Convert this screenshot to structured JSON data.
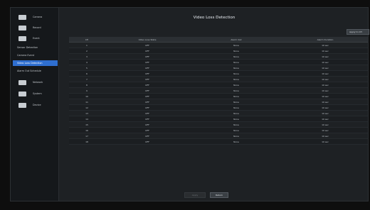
{
  "header": {
    "title": "Video Loss Detection"
  },
  "sidebar": {
    "items": [
      {
        "label": "Camera",
        "icon": "camera-icon"
      },
      {
        "label": "Record",
        "icon": "record-icon"
      },
      {
        "label": "Event",
        "icon": "event-icon"
      },
      {
        "label": "Network",
        "icon": "network-icon"
      },
      {
        "label": "System",
        "icon": "system-icon"
      },
      {
        "label": "Device",
        "icon": "device-icon"
      }
    ],
    "subitems": [
      {
        "label": "Sensor Detection"
      },
      {
        "label": "Camera Event"
      },
      {
        "label": "Video Loss Detection"
      },
      {
        "label": "Alarm Out Schedule"
      }
    ]
  },
  "toolbar": {
    "apply_to_ch_label": "Apply to CH"
  },
  "table": {
    "headers": [
      "CH",
      "Video Loss State",
      "Alarm Out",
      "Alarm Duration"
    ],
    "rows": [
      [
        "1",
        "OFF",
        "None",
        "10 sec"
      ],
      [
        "2",
        "OFF",
        "None",
        "10 sec"
      ],
      [
        "3",
        "OFF",
        "None",
        "10 sec"
      ],
      [
        "4",
        "OFF",
        "None",
        "10 sec"
      ],
      [
        "5",
        "OFF",
        "None",
        "10 sec"
      ],
      [
        "6",
        "OFF",
        "None",
        "10 sec"
      ],
      [
        "7",
        "OFF",
        "None",
        "10 sec"
      ],
      [
        "8",
        "OFF",
        "None",
        "10 sec"
      ],
      [
        "9",
        "OFF",
        "None",
        "10 sec"
      ],
      [
        "10",
        "OFF",
        "None",
        "10 sec"
      ],
      [
        "11",
        "OFF",
        "None",
        "10 sec"
      ],
      [
        "12",
        "OFF",
        "None",
        "10 sec"
      ],
      [
        "13",
        "OFF",
        "None",
        "10 sec"
      ],
      [
        "14",
        "OFF",
        "None",
        "10 sec"
      ],
      [
        "15",
        "OFF",
        "None",
        "10 sec"
      ],
      [
        "16",
        "OFF",
        "None",
        "10 sec"
      ],
      [
        "17",
        "OFF",
        "None",
        "10 sec"
      ],
      [
        "18",
        "OFF",
        "None",
        "10 sec"
      ]
    ]
  },
  "footer": {
    "apply_label": "Apply",
    "return_label": "Return"
  },
  "colors": {
    "accent": "#2f6fd0",
    "background": "#1e2124",
    "sidebar": "#15181b"
  }
}
